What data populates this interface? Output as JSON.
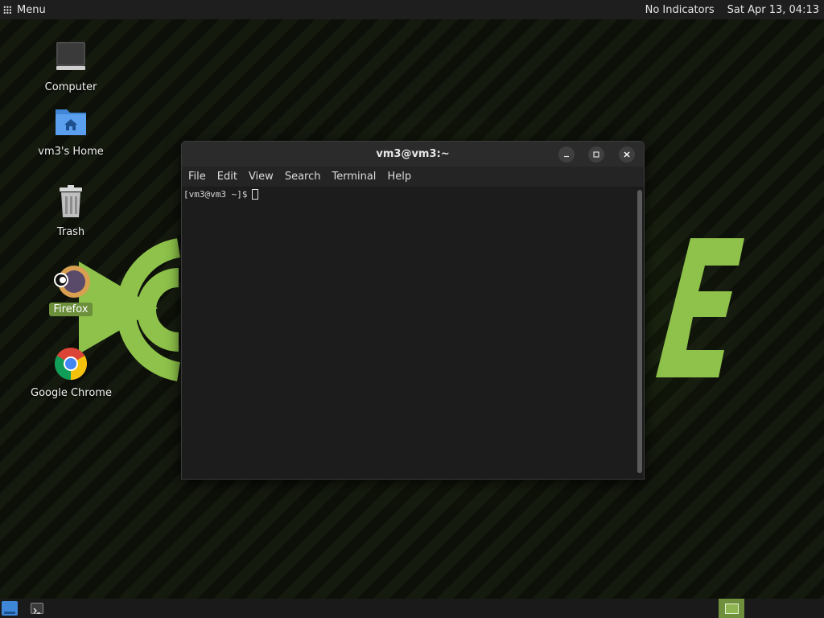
{
  "top_panel": {
    "menu_label": "Menu",
    "indicators_label": "No Indicators",
    "clock": "Sat Apr 13, 04:13"
  },
  "desktop_icons": [
    {
      "label": "Computer",
      "icon": "computer-icon"
    },
    {
      "label": "vm3's Home",
      "icon": "home-folder-icon"
    },
    {
      "label": "Trash",
      "icon": "trash-icon"
    },
    {
      "label": "Firefox",
      "icon": "firefox-icon",
      "selected": true
    },
    {
      "label": "Google Chrome",
      "icon": "chrome-icon"
    }
  ],
  "terminal": {
    "title": "vm3@vm3:~",
    "menu": [
      "File",
      "Edit",
      "View",
      "Search",
      "Terminal",
      "Help"
    ],
    "prompt": "[vm3@vm3 ~]$"
  },
  "bottom_panel": {
    "icons": [
      "show-desktop-icon",
      "terminal-task-icon",
      "workspace-switcher-icon"
    ]
  },
  "colors": {
    "accent_green": "#8bc34a",
    "panel_bg": "#1e1e1e",
    "selection_green": "#6b8f3a",
    "terminal_bg": "#1c1c1c"
  }
}
